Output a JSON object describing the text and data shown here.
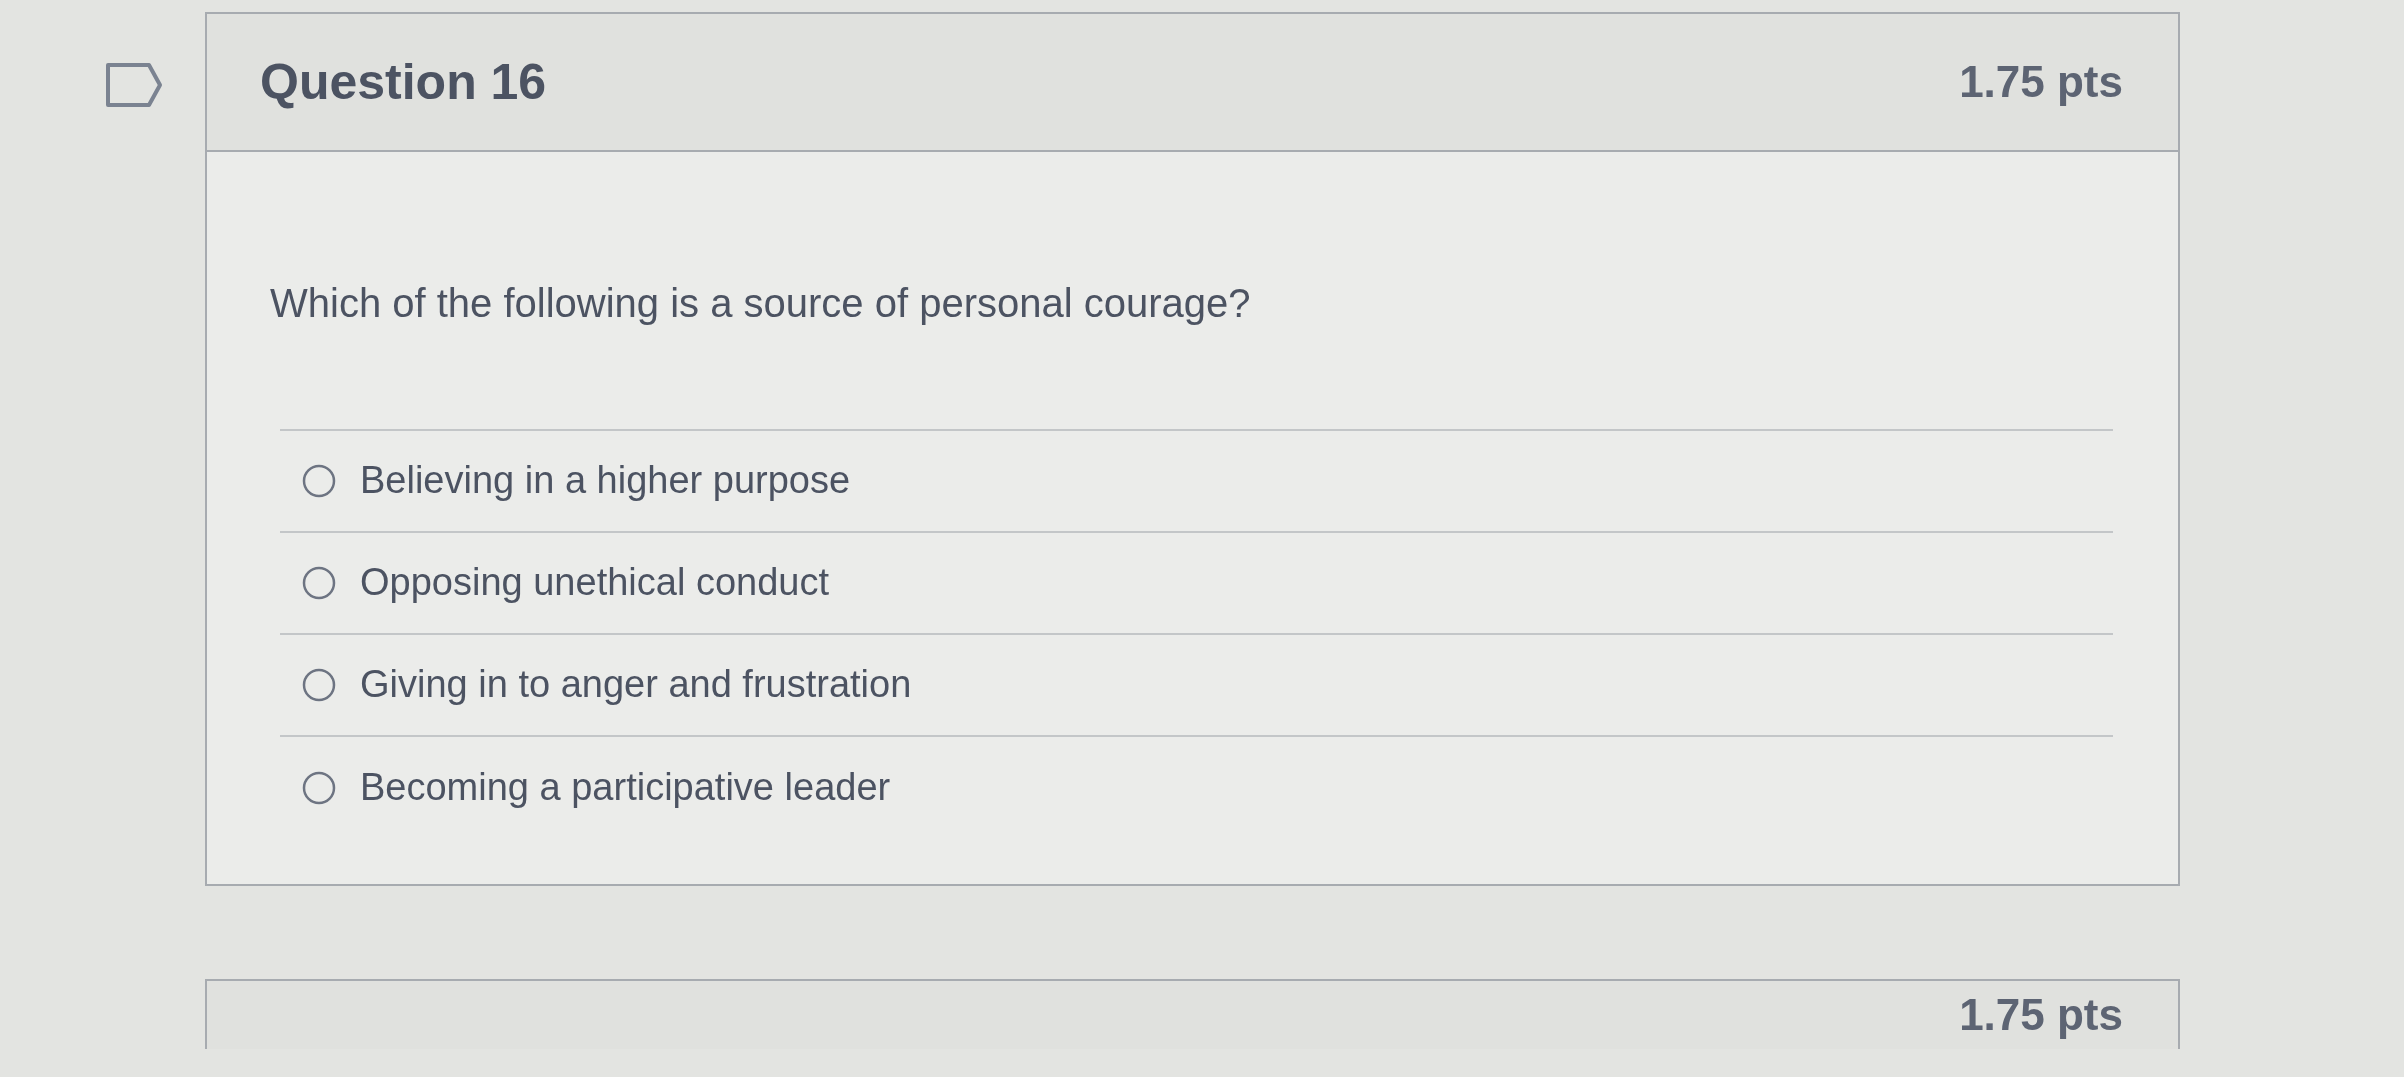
{
  "question": {
    "title": "Question 16",
    "points": "1.75 pts",
    "text": "Which of the following is a source of personal courage?",
    "answers": [
      {
        "label": "Believing in a higher purpose",
        "selected": false
      },
      {
        "label": "Opposing unethical conduct",
        "selected": false
      },
      {
        "label": "Giving in to anger and frustration",
        "selected": false
      },
      {
        "label": "Becoming a participative leader",
        "selected": false
      }
    ]
  },
  "next_question": {
    "points": "1.75 pts"
  }
}
